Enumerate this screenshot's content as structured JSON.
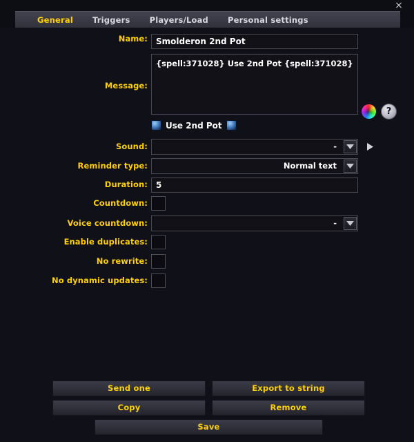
{
  "window": {
    "close_label": "×"
  },
  "tabs": [
    {
      "label": "General",
      "active": true
    },
    {
      "label": "Triggers",
      "active": false
    },
    {
      "label": "Players/Load",
      "active": false
    },
    {
      "label": "Personal settings",
      "active": false
    }
  ],
  "form": {
    "name": {
      "label": "Name:",
      "value": "Smolderon 2nd Pot",
      "placeholder": ""
    },
    "message": {
      "label": "Message:",
      "value": "{spell:371028} Use 2nd Pot {spell:371028}",
      "placeholder": ""
    },
    "preview": {
      "text": "Use 2nd Pot",
      "left_icon": "spell-icon",
      "right_icon": "spell-icon"
    },
    "sound": {
      "label": "Sound:",
      "value": "-",
      "play_icon": "play-icon"
    },
    "reminder_type": {
      "label": "Reminder type:",
      "value": "Normal text"
    },
    "duration": {
      "label": "Duration:",
      "value": "5",
      "placeholder": ""
    },
    "countdown": {
      "label": "Countdown:",
      "checked": false
    },
    "voice_countdown": {
      "label": "Voice countdown:",
      "value": "-"
    },
    "enable_duplicates": {
      "label": "Enable duplicates:",
      "checked": false
    },
    "no_rewrite": {
      "label": "No rewrite:",
      "checked": false
    },
    "no_dynamic_updates": {
      "label": "No dynamic updates:",
      "checked": false
    }
  },
  "controls": {
    "color_picker": "color-wheel-icon",
    "help": "?"
  },
  "buttons": {
    "send_one": "Send one",
    "export_to_string": "Export to string",
    "copy": "Copy",
    "remove": "Remove",
    "save": "Save"
  },
  "colors": {
    "accent": "#ffd100",
    "background": "#101018",
    "field_bg": "#111117",
    "field_border": "#4a4a55",
    "tab_bar": "#3a3a46",
    "text": "#ffffff"
  }
}
